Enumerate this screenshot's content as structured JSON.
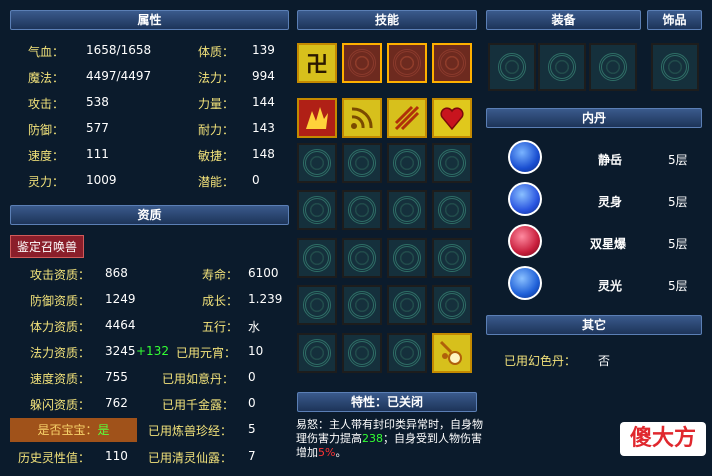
{
  "headers": {
    "attributes": "属性",
    "skills": "技能",
    "equipment": "装备",
    "accessory": "饰品",
    "qualification": "资质",
    "inner_dan": "内丹",
    "other": "其它",
    "traits": "特性：已关闭"
  },
  "attributes": {
    "hp_label": "气血：",
    "hp_value": "1658/1658",
    "mp_label": "魔法：",
    "mp_value": "4497/4497",
    "atk_label": "攻击：",
    "atk_value": "538",
    "def_label": "防御：",
    "def_value": "577",
    "spd_label": "速度：",
    "spd_value": "111",
    "spi_label": "灵力：",
    "spi_value": "1009",
    "con_label": "体质：",
    "con_value": "139",
    "mag_label": "法力：",
    "mag_value": "994",
    "str_label": "力量：",
    "str_value": "144",
    "end_label": "耐力：",
    "end_value": "143",
    "agi_label": "敏捷：",
    "agi_value": "148",
    "pot_label": "潜能：",
    "pot_value": "0"
  },
  "identify_button": "鉴定召唤兽",
  "qualification": {
    "atk_q_label": "攻击资质：",
    "atk_q_value": "868",
    "def_q_label": "防御资质：",
    "def_q_value": "1249",
    "hp_q_label": "体力资质：",
    "hp_q_value": "4464",
    "mag_q_label": "法力资质：",
    "mag_q_value": "3245",
    "mag_q_bonus": "+132",
    "spd_q_label": "速度资质：",
    "spd_q_value": "755",
    "dodge_q_label": "躲闪资质：",
    "dodge_q_value": "762",
    "baby_label": "是否宝宝：",
    "baby_value": "是",
    "history_label": "历史灵性值：",
    "history_value": "110",
    "life_label": "寿命：",
    "life_value": "6100",
    "growth_label": "成长：",
    "growth_value": "1.239",
    "element_label": "五行：",
    "element_value": "水",
    "yuanxiao_label": "已用元宵：",
    "yuanxiao_value": "10",
    "ruyi_label": "已用如意丹：",
    "ruyi_value": "0",
    "qianjin_label": "已用千金露：",
    "qianjin_value": "0",
    "lianshou_label": "已用炼兽珍经：",
    "lianshou_value": "5",
    "qingling_label": "已用清灵仙露：",
    "qingling_value": "7"
  },
  "inner_dan": [
    {
      "name": "静岳",
      "level": "5层",
      "color": "#1a4fd1",
      "icon": "mountain-orb-icon"
    },
    {
      "name": "灵身",
      "level": "5层",
      "color": "#2a55e0",
      "icon": "spirit-body-orb-icon"
    },
    {
      "name": "双星爆",
      "level": "5层",
      "color": "#c81e3c",
      "icon": "double-star-orb-icon"
    },
    {
      "name": "灵光",
      "level": "5层",
      "color": "#1f60d8",
      "icon": "spirit-light-orb-icon"
    }
  ],
  "other": {
    "dye_label": "已用幻色丹：",
    "dye_value": "否"
  },
  "trait_text": {
    "prefix": "易怒：",
    "part1": "主人带有封印类异常时，自身物理伤害力提高",
    "num1": "238",
    "part2": "；自身受到人物伤害增加",
    "num2": "5%",
    "end": "。"
  },
  "watermark": "傻大方",
  "colors": {
    "label": "#f2e27a",
    "value": "#ffffff",
    "bonus": "#33ff33",
    "header": "#2d4c7c"
  }
}
